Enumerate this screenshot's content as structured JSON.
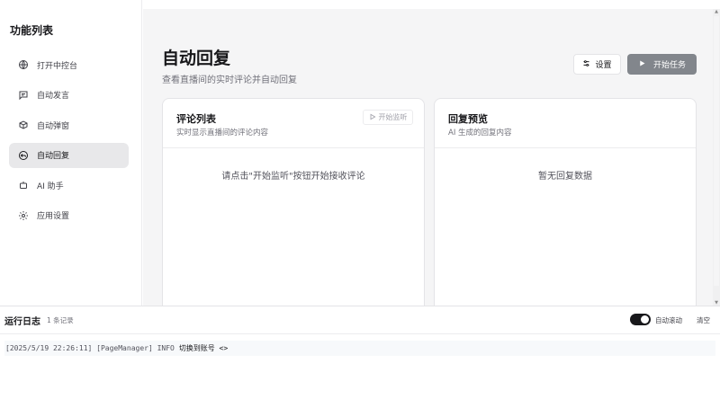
{
  "sidebar": {
    "title": "功能列表",
    "items": [
      {
        "label": "打开中控台",
        "icon": "globe-icon",
        "active": false
      },
      {
        "label": "自动发言",
        "icon": "message-icon",
        "active": false
      },
      {
        "label": "自动弹窗",
        "icon": "package-icon",
        "active": false
      },
      {
        "label": "自动回复",
        "icon": "reply-icon",
        "active": true
      },
      {
        "label": "AI 助手",
        "icon": "bot-icon",
        "active": false
      },
      {
        "label": "应用设置",
        "icon": "gear-icon",
        "active": false
      }
    ]
  },
  "main": {
    "title": "自动回复",
    "subtitle": "查看直播间的实时评论并自动回复",
    "settings_label": "设置",
    "start_label": "开始任务",
    "comments": {
      "title": "评论列表",
      "desc": "实时显示直播间的评论内容",
      "action_label": "开始监听",
      "empty": "请点击\"开始监听\"按钮开始接收评论"
    },
    "preview": {
      "title": "回复预览",
      "desc": "AI 生成的回复内容",
      "empty": "暂无回复数据"
    }
  },
  "log": {
    "title": "运行日志",
    "count": "1 条记录",
    "auto_scroll_label": "自动滚动",
    "auto_scroll_on": true,
    "clear_label": "清空",
    "entries": [
      {
        "time": "[2025/5/19 22:26:11]",
        "source": "[PageManager]",
        "level": "INFO",
        "message": "切换到账号 <>"
      }
    ]
  },
  "colors": {
    "primary_button": "#82868c",
    "active_nav": "#e8e8ea",
    "main_bg": "#f5f5f6"
  }
}
